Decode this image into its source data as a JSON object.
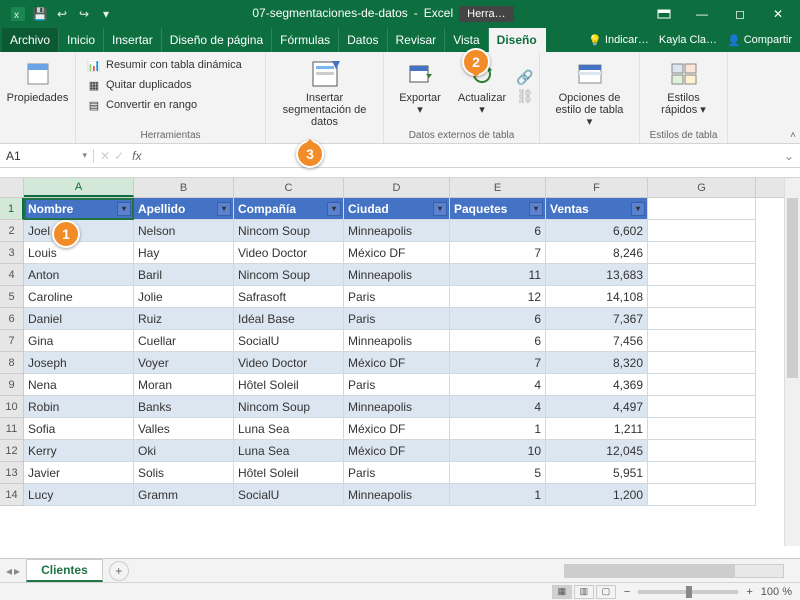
{
  "titlebar": {
    "docname": "07-segmentaciones-de-datos",
    "app": "Excel",
    "tooltab": "Herra…"
  },
  "menu": {
    "file": "Archivo",
    "home": "Inicio",
    "insert": "Insertar",
    "pagelayout": "Diseño de página",
    "formulas": "Fórmulas",
    "data": "Datos",
    "review": "Revisar",
    "view": "Vista",
    "design": "Diseño",
    "tell": "Indicar…",
    "user": "Kayla Cla…",
    "share": "Compartir"
  },
  "ribbon": {
    "properties": "Propiedades",
    "pivot": "Resumir con tabla dinámica",
    "dedup": "Quitar duplicados",
    "torange": "Convertir en rango",
    "g_tools": "Herramientas",
    "slicer": "Insertar segmentación de datos",
    "export": "Exportar",
    "refresh": "Actualizar",
    "g_ext": "Datos externos de tabla",
    "styleopts": "Opciones de estilo de tabla",
    "quickstyles": "Estilos rápidos",
    "g_styles": "Estilos de tabla"
  },
  "formula": {
    "namebox": "A1",
    "fx": "fx"
  },
  "cols": [
    "A",
    "B",
    "C",
    "D",
    "E",
    "F",
    "G"
  ],
  "headers": [
    "Nombre",
    "Apellido",
    "Compañía",
    "Ciudad",
    "Paquetes",
    "Ventas"
  ],
  "rows": [
    {
      "n": "Joel",
      "a": "Nelson",
      "c": "Nincom Soup",
      "ci": "Minneapolis",
      "p": "6",
      "v": "6,602"
    },
    {
      "n": "Louis",
      "a": "Hay",
      "c": "Video Doctor",
      "ci": "México DF",
      "p": "7",
      "v": "8,246"
    },
    {
      "n": "Anton",
      "a": "Baril",
      "c": "Nincom Soup",
      "ci": "Minneapolis",
      "p": "11",
      "v": "13,683"
    },
    {
      "n": "Caroline",
      "a": "Jolie",
      "c": "Safrasoft",
      "ci": "Paris",
      "p": "12",
      "v": "14,108"
    },
    {
      "n": "Daniel",
      "a": "Ruiz",
      "c": "Idéal Base",
      "ci": "Paris",
      "p": "6",
      "v": "7,367"
    },
    {
      "n": "Gina",
      "a": "Cuellar",
      "c": "SocialU",
      "ci": "Minneapolis",
      "p": "6",
      "v": "7,456"
    },
    {
      "n": "Joseph",
      "a": "Voyer",
      "c": "Video Doctor",
      "ci": "México DF",
      "p": "7",
      "v": "8,320"
    },
    {
      "n": "Nena",
      "a": "Moran",
      "c": "Hôtel Soleil",
      "ci": "Paris",
      "p": "4",
      "v": "4,369"
    },
    {
      "n": "Robin",
      "a": "Banks",
      "c": "Nincom Soup",
      "ci": "Minneapolis",
      "p": "4",
      "v": "4,497"
    },
    {
      "n": "Sofia",
      "a": "Valles",
      "c": "Luna Sea",
      "ci": "México DF",
      "p": "1",
      "v": "1,211"
    },
    {
      "n": "Kerry",
      "a": "Oki",
      "c": "Luna Sea",
      "ci": "México DF",
      "p": "10",
      "v": "12,045"
    },
    {
      "n": "Javier",
      "a": "Solis",
      "c": "Hôtel Soleil",
      "ci": "Paris",
      "p": "5",
      "v": "5,951"
    },
    {
      "n": "Lucy",
      "a": "Gramm",
      "c": "SocialU",
      "ci": "Minneapolis",
      "p": "1",
      "v": "1,200"
    }
  ],
  "sheet": {
    "name": "Clientes"
  },
  "status": {
    "zoom": "100 %"
  },
  "callouts": {
    "one": "1",
    "two": "2",
    "three": "3"
  }
}
